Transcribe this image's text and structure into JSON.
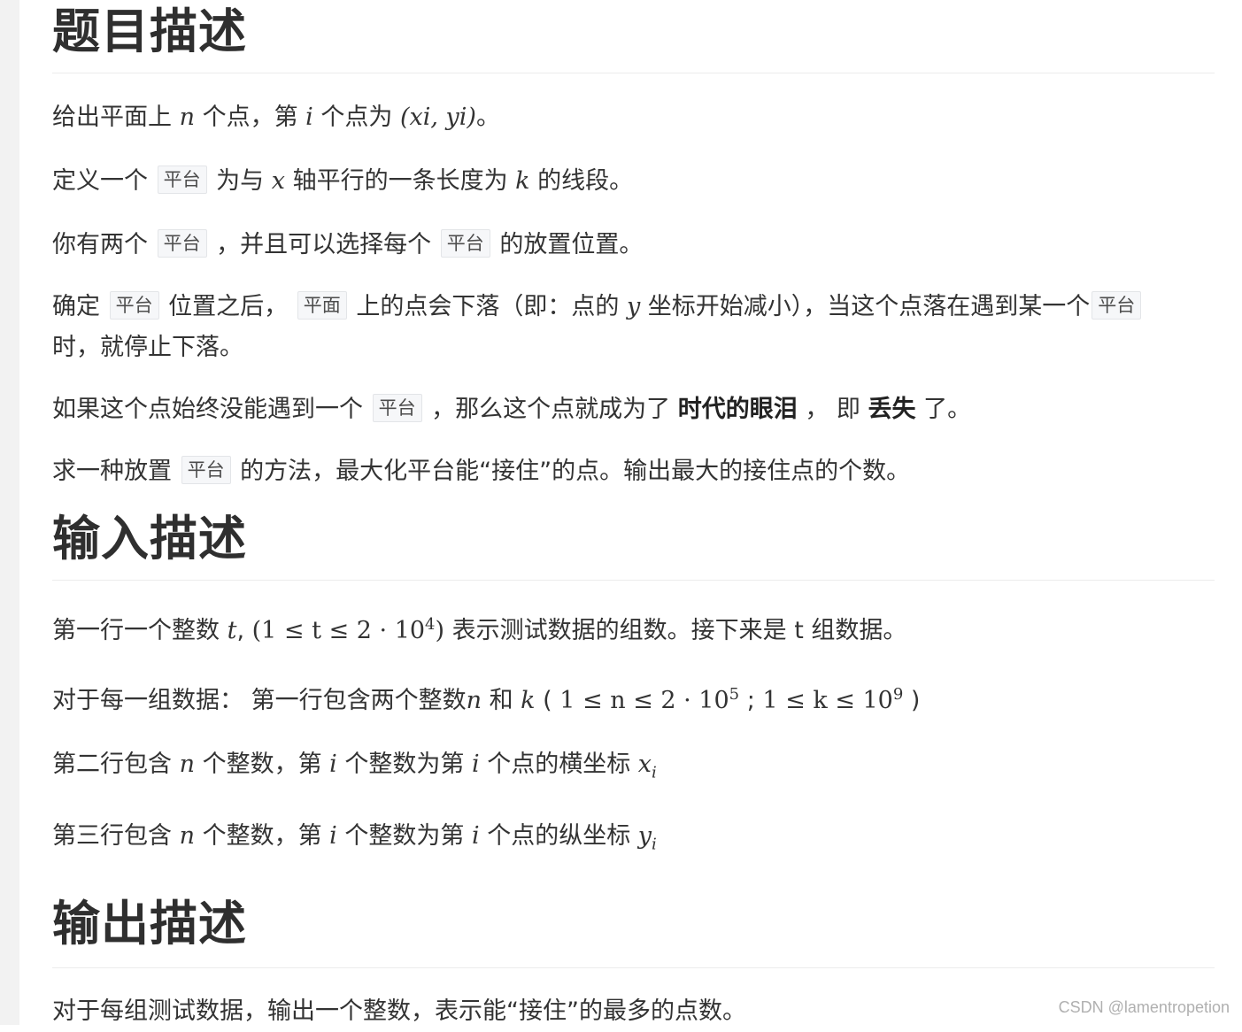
{
  "sections": {
    "problem": {
      "title": "题目描述",
      "p1": {
        "a": "给出平面上 ",
        "n": "n",
        "b": " 个点，第 ",
        "i": "i",
        "c": " 个点为 ",
        "coord": "(xi, yi)",
        "d": "。"
      },
      "p2": {
        "a": "定义一个 ",
        "tag": "平台",
        "b": " 为与 ",
        "x": "x",
        "c": " 轴平行的一条长度为 ",
        "k": "k",
        "d": " 的线段。"
      },
      "p3": {
        "a": "你有两个 ",
        "tag1": "平台",
        "b": " ，并且可以选择每个 ",
        "tag2": "平台",
        "c": " 的放置位置。"
      },
      "p4": {
        "a": "确定 ",
        "tag1": "平台",
        "b": " 位置之后， ",
        "tag2": "平面",
        "c": " 上的点会下落（即：点的 ",
        "y": "y",
        "d": " 坐标开始减小），当这个点落在遇到某一个",
        "tag3": "平台",
        "e": " 时，就停止下落。"
      },
      "p5": {
        "a": "如果这个点始终没能遇到一个 ",
        "tag": "平台",
        "b": " ，那么这个点就成为了 ",
        "bold1": "时代的眼泪",
        "c": " ， 即 ",
        "bold2": "丢失",
        "d": " 了。"
      },
      "p6": {
        "a": "求一种放置 ",
        "tag": "平台",
        "b": " 的方法，最大化平台能“接住”的点。输出最大的接住点的个数。"
      }
    },
    "input": {
      "title": "输入描述",
      "p1": {
        "a": "第一行一个整数 ",
        "t": "t",
        "b": ", ",
        "range": "(1 ≤ t ≤ 2 · 10",
        "exp": "4",
        "close": ")",
        "c": " 表示测试数据的组数。接下来是 t 组数据。"
      },
      "p2": {
        "a": "对于每一组数据： 第一行包含两个整数",
        "n": "n",
        "b": " 和 ",
        "k": "k",
        "c": " ( ",
        "r1": "1 ≤ n ≤ 2 · 10",
        "e1": "5",
        "sep": " ; ",
        "r2": "1 ≤ k ≤ 10",
        "e2": "9",
        "d": " )"
      },
      "p3": {
        "a": "第二行包含 ",
        "n": "n",
        "b": " 个整数，第 ",
        "i1": "i",
        "c": " 个整数为第 ",
        "i2": "i",
        "d": " 个点的横坐标 ",
        "x": "x",
        "sub": "i"
      },
      "p4": {
        "a": "第三行包含 ",
        "n": "n",
        "b": " 个整数，第 ",
        "i1": "i",
        "c": " 个整数为第 ",
        "i2": "i",
        "d": " 个点的纵坐标 ",
        "y": "y",
        "sub": "i"
      }
    },
    "output": {
      "title": "输出描述",
      "p1": "对于每组测试数据，输出一个整数，表示能“接住”的最多的点数。"
    }
  },
  "watermark": "CSDN @lamentropetion"
}
